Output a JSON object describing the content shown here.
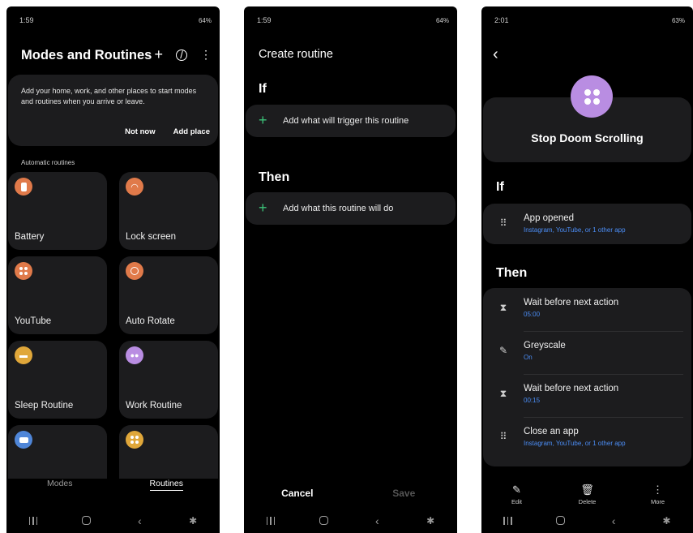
{
  "panel1": {
    "status_time": "1:59",
    "status_right": "64%",
    "title": "Modes and Routines",
    "banner_text": "Add your home, work, and other places to start modes and routines when you arrive or leave.",
    "not_now": "Not now",
    "add_place": "Add place",
    "section_label": "Automatic routines",
    "tiles": [
      {
        "label": "Battery",
        "color": "#e07a4a"
      },
      {
        "label": "Lock screen",
        "color": "#e07a4a"
      },
      {
        "label": "YouTube",
        "color": "#e07a4a"
      },
      {
        "label": "Auto Rotate",
        "color": "#e07a4a"
      },
      {
        "label": "Sleep Routine",
        "color": "#e0a73a"
      },
      {
        "label": "Work Routine",
        "color": "#b98de2"
      },
      {
        "label": "",
        "color": "#4f86d8"
      },
      {
        "label": "",
        "color": "#e0a73a"
      }
    ],
    "tab_modes": "Modes",
    "tab_routines": "Routines"
  },
  "panel2": {
    "status_time": "1:59",
    "status_right": "64%",
    "title": "Create routine",
    "if_label": "If",
    "if_action": "Add what will trigger this routine",
    "then_label": "Then",
    "then_action": "Add what this routine will do",
    "cancel": "Cancel",
    "save": "Save"
  },
  "panel3": {
    "status_time": "2:01",
    "status_right": "63%",
    "routine_name": "Stop Doom Scrolling",
    "if_label": "If",
    "if_item": {
      "title": "App opened",
      "sub": "Instagram, YouTube, or 1 other app"
    },
    "then_label": "Then",
    "then_items": [
      {
        "title": "Wait before next action",
        "sub": "05:00",
        "icon": "hourglass-icon"
      },
      {
        "title": "Greyscale",
        "sub": "On",
        "icon": "eyedropper-icon"
      },
      {
        "title": "Wait before next action",
        "sub": "00:15",
        "icon": "hourglass-icon"
      },
      {
        "title": "Close an app",
        "sub": "Instagram, YouTube, or 1 other app",
        "icon": "apps-icon"
      }
    ],
    "edit": "Edit",
    "delete": "Delete",
    "more": "More"
  },
  "accent_green": "#3cc47a",
  "accent_blue": "#4b8df5"
}
